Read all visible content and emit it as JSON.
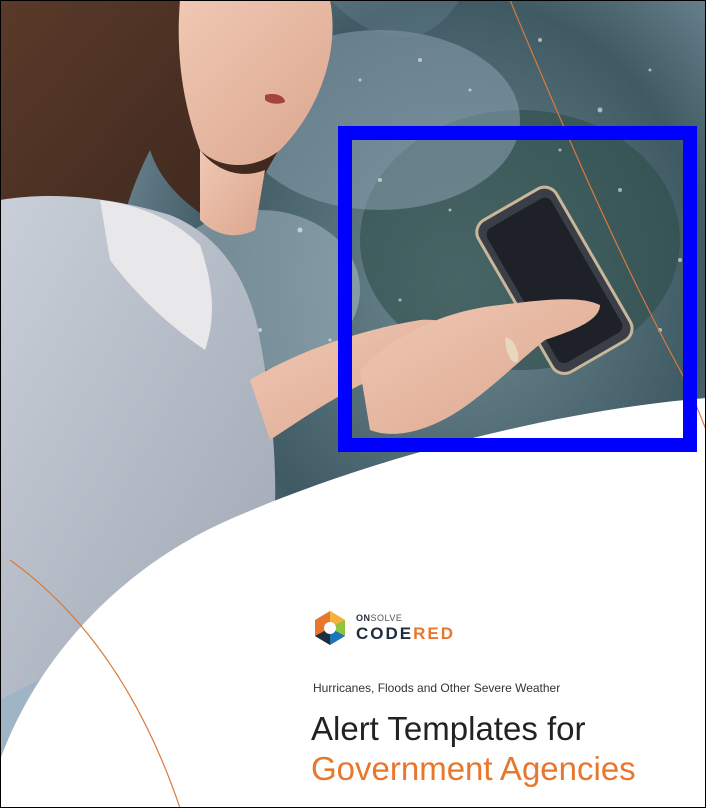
{
  "brand": {
    "prefix_bold": "ON",
    "prefix_light": "SOLVE",
    "name_part1": "CODE",
    "name_part2": "RED"
  },
  "subtitle": "Hurricanes, Floods and Other Severe Weather",
  "title": {
    "line1": "Alert Templates for",
    "line2": "Government Agencies"
  },
  "colors": {
    "accent": "#e8772e",
    "highlight_box": "#0000ff",
    "dark_text": "#222222"
  }
}
